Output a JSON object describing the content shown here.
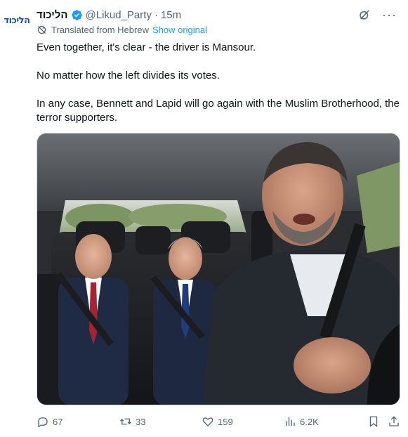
{
  "author": {
    "avatar_text": "הליכוד",
    "display_name": "הליכוד",
    "handle": "@Likud_Party",
    "separator": "·",
    "time": "15m"
  },
  "translation": {
    "notice": "Translated from Hebrew",
    "show_original": "Show original"
  },
  "tweet": {
    "paragraphs": [
      "Even together, it's clear - the driver is Mansour.",
      "No matter how the left divides its votes.",
      "In any case, Bennett and Lapid will go again with the Muslim Brotherhood, the terror supporters."
    ]
  },
  "actions": {
    "replies": "67",
    "reposts": "33",
    "likes": "159",
    "views": "6.2K"
  },
  "icons": {
    "verified": "verified-badge-icon",
    "grok": "grok-icon",
    "more": "more-icon",
    "translate": "translate-icon",
    "reply": "reply-icon",
    "repost": "repost-icon",
    "like": "heart-icon",
    "views": "views-chart-icon",
    "bookmark": "bookmark-icon",
    "share": "share-icon"
  },
  "colors": {
    "link": "#1d9bf0",
    "muted": "#536471",
    "text": "#0f1419",
    "brand": "#1a4fa0"
  }
}
